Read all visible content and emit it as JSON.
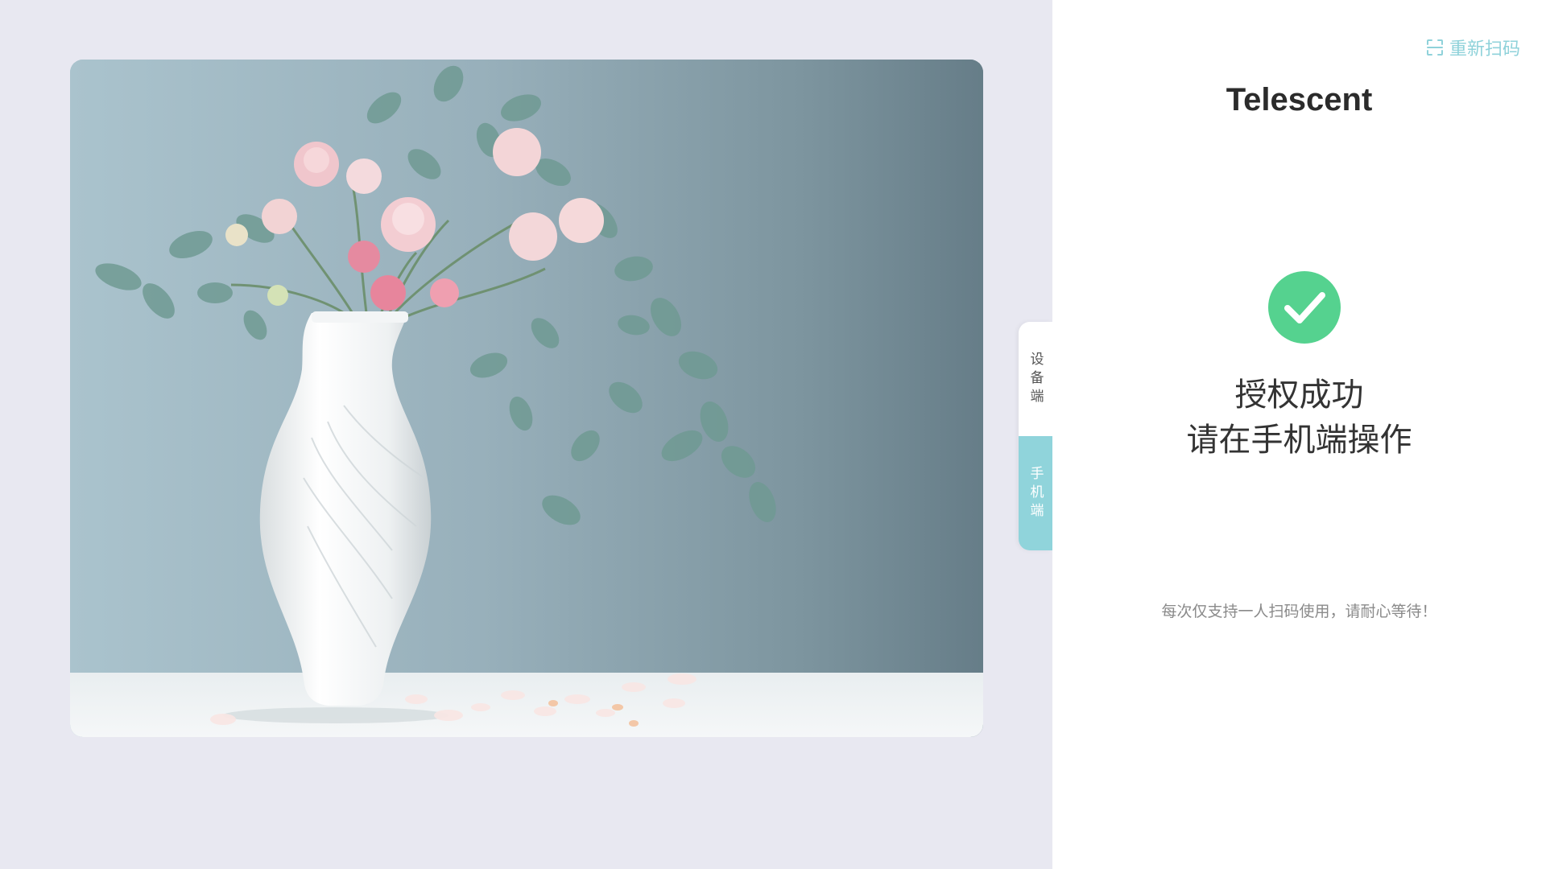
{
  "side_tabs": {
    "device_label": "设备端",
    "mobile_label": "手机端"
  },
  "panel": {
    "rescan_label": "重新扫码",
    "brand_title": "Telescent",
    "status_line1": "授权成功",
    "status_line2": "请在手机端操作",
    "hint": "每次仅支持一人扫码使用，请耐心等待！"
  },
  "icons": {
    "rescan": "scan-icon",
    "success": "check-circle-icon"
  },
  "colors": {
    "accent": "#8fd2da",
    "success": "#55d28f",
    "page_bg": "#e8e8f1",
    "panel_bg": "#ffffff"
  }
}
